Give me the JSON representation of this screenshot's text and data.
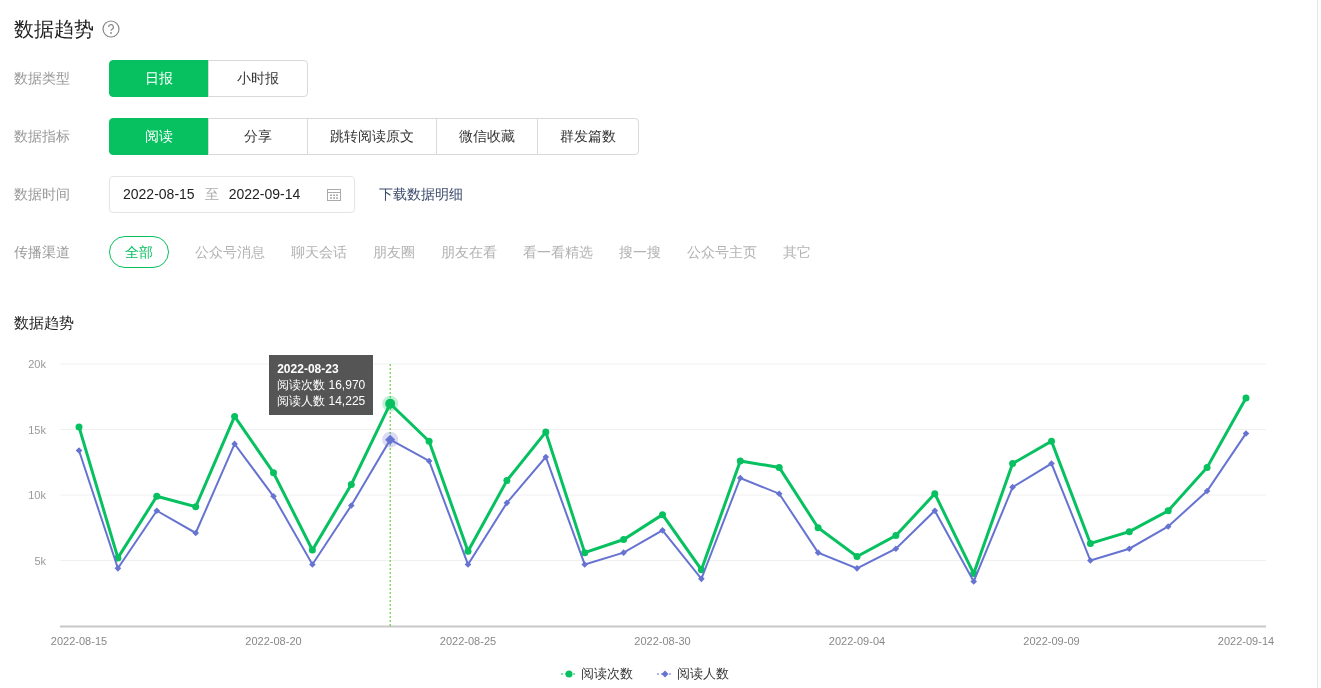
{
  "header": {
    "title": "数据趋势"
  },
  "filters": {
    "data_type": {
      "label": "数据类型",
      "options": [
        {
          "label": "日报",
          "selected": true
        },
        {
          "label": "小时报",
          "selected": false
        }
      ]
    },
    "metric": {
      "label": "数据指标",
      "options": [
        {
          "label": "阅读",
          "selected": true
        },
        {
          "label": "分享",
          "selected": false
        },
        {
          "label": "跳转阅读原文",
          "selected": false
        },
        {
          "label": "微信收藏",
          "selected": false
        },
        {
          "label": "群发篇数",
          "selected": false
        }
      ]
    },
    "date": {
      "label": "数据时间",
      "start": "2022-08-15",
      "separator": "至",
      "end": "2022-09-14",
      "download_link": "下载数据明细"
    },
    "channel": {
      "label": "传播渠道",
      "options": [
        {
          "label": "全部",
          "selected": true
        },
        {
          "label": "公众号消息",
          "selected": false
        },
        {
          "label": "聊天会话",
          "selected": false
        },
        {
          "label": "朋友圈",
          "selected": false
        },
        {
          "label": "朋友在看",
          "selected": false
        },
        {
          "label": "看一看精选",
          "selected": false
        },
        {
          "label": "搜一搜",
          "selected": false
        },
        {
          "label": "公众号主页",
          "selected": false
        },
        {
          "label": "其它",
          "selected": false
        }
      ]
    }
  },
  "trend": {
    "title": "数据趋势",
    "chart_data": {
      "type": "line",
      "grid": true,
      "categories": [
        "2022-08-15",
        null,
        null,
        null,
        null,
        "2022-08-20",
        null,
        null,
        null,
        null,
        "2022-08-25",
        null,
        null,
        null,
        null,
        "2022-08-30",
        null,
        null,
        null,
        null,
        "2022-09-04",
        null,
        null,
        null,
        null,
        "2022-09-09",
        null,
        null,
        null,
        null,
        "2022-09-14"
      ],
      "series": [
        {
          "name": "阅读次数",
          "color": "#07c160",
          "marker": "circle",
          "values": [
            15200,
            5200,
            9900,
            9100,
            16000,
            11700,
            5800,
            10800,
            16970,
            14100,
            5700,
            11100,
            14800,
            5600,
            6600,
            8500,
            4300,
            12600,
            12100,
            7500,
            5300,
            6900,
            10100,
            4000,
            12400,
            14100,
            6300,
            7200,
            8800,
            12100,
            17400
          ]
        },
        {
          "name": "阅读人数",
          "color": "#6673d1",
          "marker": "diamond",
          "values": [
            13400,
            4400,
            8800,
            7100,
            13900,
            9900,
            4700,
            9200,
            14225,
            12600,
            4700,
            9400,
            12900,
            4700,
            5600,
            7300,
            3600,
            11300,
            10100,
            5600,
            4400,
            5900,
            8800,
            3400,
            10600,
            12400,
            5000,
            5900,
            7600,
            10300,
            14700
          ]
        }
      ],
      "ylim": [
        0,
        20000
      ],
      "yticks": [
        {
          "value": 5000,
          "label": "5k"
        },
        {
          "value": 10000,
          "label": "10k"
        },
        {
          "value": 15000,
          "label": "15k"
        },
        {
          "value": 20000,
          "label": "20k"
        }
      ],
      "xlabel": null
    },
    "tooltip": {
      "title": "2022-08-23",
      "lines": [
        "阅读次数 16,970",
        "阅读人数 14,225"
      ]
    }
  }
}
